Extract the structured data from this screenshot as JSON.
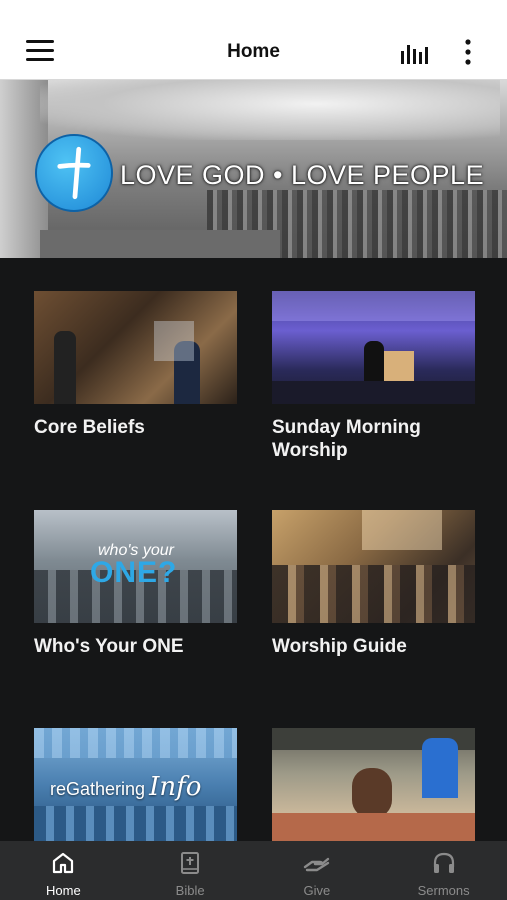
{
  "header": {
    "title": "Home",
    "menu_icon": "hamburger-menu-icon",
    "chart_icon": "audio-bars-icon",
    "more_icon": "more-vertical-icon"
  },
  "hero": {
    "tagline": "LOVE GOD • LOVE PEOPLE",
    "logo_icon": "cross-logo-icon",
    "logo_color": "#2b9fe6"
  },
  "tiles": [
    {
      "label": "Core Beliefs"
    },
    {
      "label": "Sunday Morning Worship"
    },
    {
      "label": "Who's Your ONE",
      "thumb_text_small": "who's your",
      "thumb_text_big": "ONE?"
    },
    {
      "label": "Worship Guide"
    },
    {
      "label": "",
      "thumb_text": "reGathering",
      "thumb_script": "Info"
    },
    {
      "label": ""
    }
  ],
  "tabbar": {
    "items": [
      {
        "label": "Home",
        "icon": "home-icon",
        "active": true
      },
      {
        "label": "Bible",
        "icon": "bible-icon",
        "active": false
      },
      {
        "label": "Give",
        "icon": "give-hand-icon",
        "active": false
      },
      {
        "label": "Sermons",
        "icon": "headphones-icon",
        "active": false
      }
    ],
    "active_color": "#ffffff",
    "inactive_color": "#8b8b8b"
  }
}
